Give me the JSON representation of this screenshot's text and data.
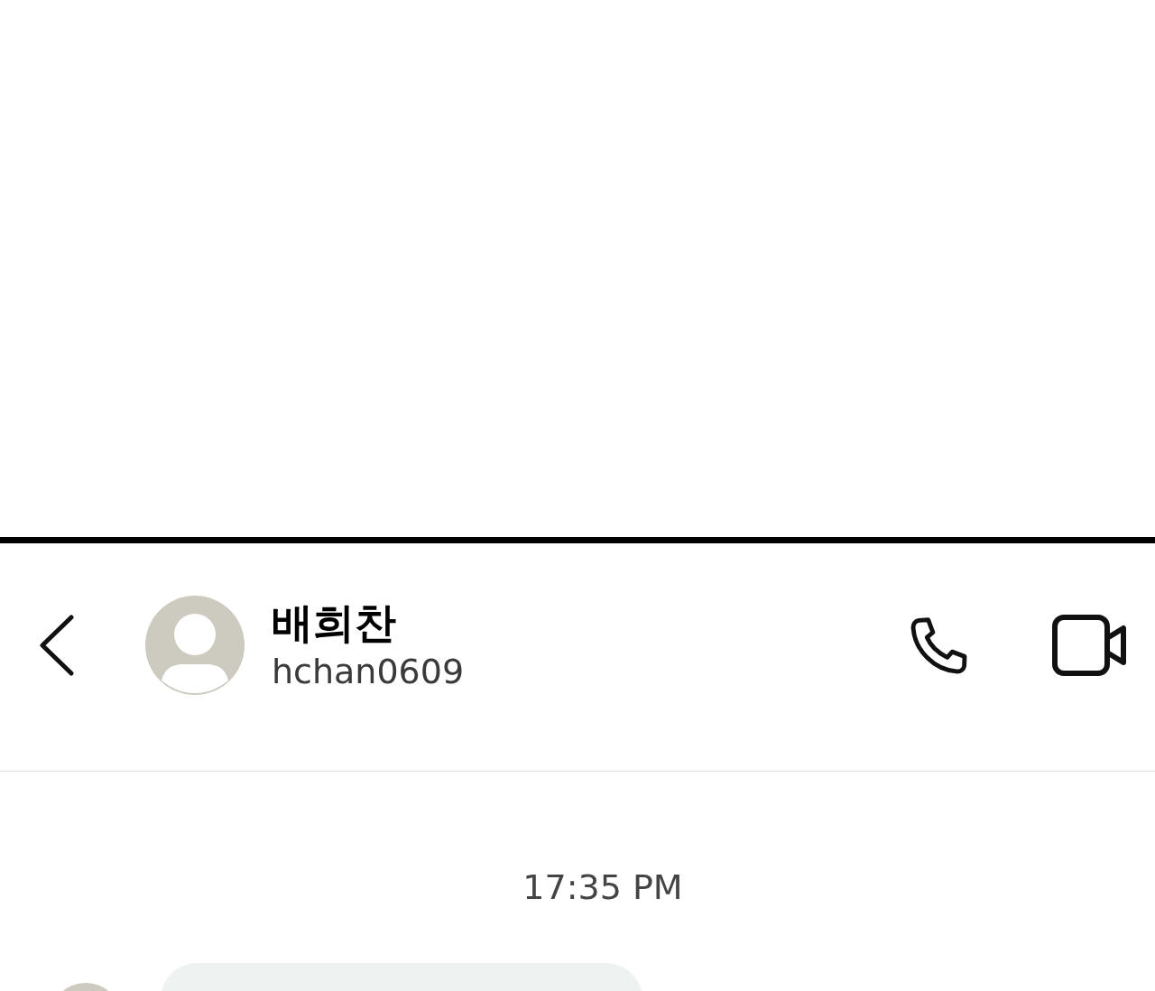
{
  "contact": {
    "name": "배희찬",
    "username": "hchan0609"
  },
  "timestamp": "17:35 PM",
  "messages": [
    {
      "kind": "received"
    }
  ]
}
